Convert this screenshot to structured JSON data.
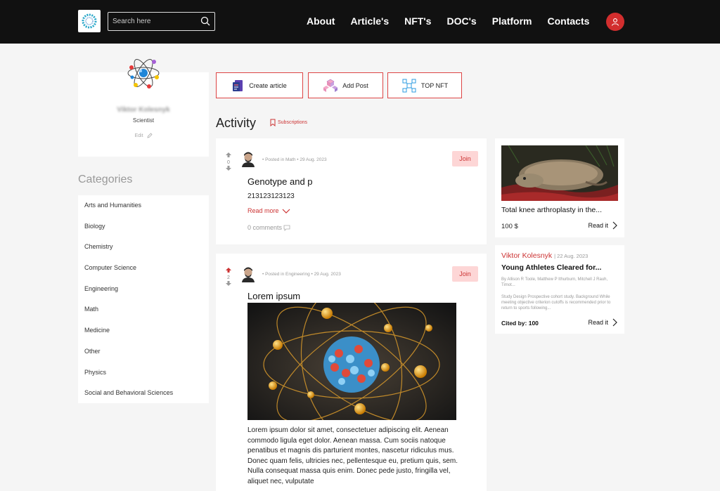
{
  "header": {
    "search_placeholder": "Search here",
    "nav": [
      "About",
      "Article's",
      "NFT's",
      "DOC's",
      "Platform",
      "Contacts"
    ]
  },
  "profile": {
    "name": "Viktor Kolesnyk",
    "role": "Scientist",
    "edit_label": "Edit"
  },
  "categories": {
    "title": "Categories",
    "items": [
      "Arts and Humanities",
      "Biology",
      "Chemistry",
      "Computer Science",
      "Engineering",
      "Math",
      "Medicine",
      "Other",
      "Physics",
      "Social and Behavioral Sciences"
    ]
  },
  "actions": {
    "create_article": "Create article",
    "add_post": "Add Post",
    "top_nft": "TOP NFT"
  },
  "feed": {
    "title": "Activity",
    "subscriptions": "Subscriptions",
    "posts": [
      {
        "votes": "0",
        "meta": "• Posted in Math  • 29 Aug. 2023",
        "join": "Join",
        "title": "Genotype and p",
        "body": "213123123123",
        "read_more": "Read more",
        "comments": "0 comments"
      },
      {
        "votes": "2",
        "meta": "• Posted in Engineering  • 29 Aug. 2023",
        "join": "Join",
        "title": "Lorem ipsum",
        "body": "Lorem ipsum dolor sit amet, consectetuer adipiscing elit. Aenean commodo ligula eget dolor. Aenean massa. Cum sociis natoque penatibus et magnis dis parturient montes, nascetur ridiculus mus. Donec quam felis, ultricies nec, pellentesque eu, pretium quis, sem. Nulla consequat massa quis enim. Donec pede justo, fringilla vel, aliquet nec, vulputate"
      }
    ]
  },
  "nft_card": {
    "title": "Total knee arthroplasty in the...",
    "price": "100 $",
    "read_it": "Read it"
  },
  "article_card": {
    "author": "Viktor Kolesnyk",
    "date": "| 22 Aug. 2023",
    "title": "Young Athletes Cleared for...",
    "authors": "By Allison R Toole, Matthew P Ithurburn, Mitchell J Rauh, Timot...",
    "abstract": "Study Design Prospective cohort study. Background While meeting objective criterion cutoffs is recommended prior to return to sports following...",
    "cited": "Cited by: 100",
    "read_it": "Read it"
  },
  "colors": {
    "accent": "#c33333",
    "header": "#111111",
    "join_bg": "#fdd6d6"
  }
}
